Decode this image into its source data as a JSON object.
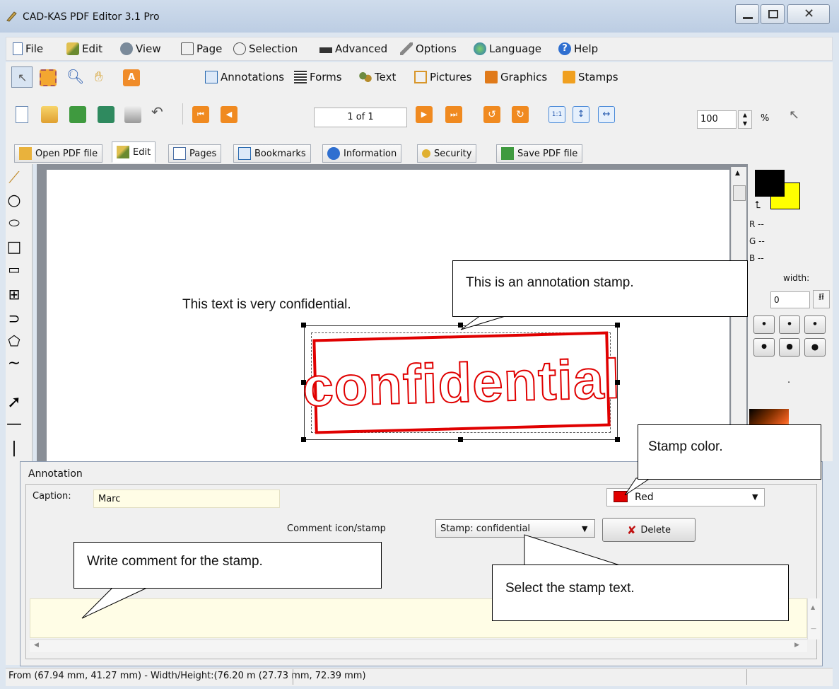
{
  "window": {
    "title": "CAD-KAS PDF Editor 3.1 Pro"
  },
  "menu": [
    {
      "label": "File",
      "icon": "document-icon"
    },
    {
      "label": "Edit",
      "icon": "brush-icon"
    },
    {
      "label": "View",
      "icon": "globe-icon"
    },
    {
      "label": "Page",
      "icon": "book-icon"
    },
    {
      "label": "Selection",
      "icon": "lasso-icon"
    },
    {
      "label": "Advanced",
      "icon": "graduation-cap-icon"
    },
    {
      "label": "Options",
      "icon": "wrench-icon"
    },
    {
      "label": "Language",
      "icon": "globe-icon"
    },
    {
      "label": "Help",
      "icon": "help-icon"
    }
  ],
  "toolbar_modes": [
    {
      "label": "Annotations"
    },
    {
      "label": "Forms"
    },
    {
      "label": "Text"
    },
    {
      "label": "Pictures"
    },
    {
      "label": "Graphics"
    },
    {
      "label": "Stamps"
    }
  ],
  "navigation": {
    "page_indicator": "1 of 1",
    "zoom_value": "100",
    "zoom_unit": "%",
    "actual_size": "1:1"
  },
  "tabs": [
    {
      "label": "Open PDF file"
    },
    {
      "label": "Edit"
    },
    {
      "label": "Pages"
    },
    {
      "label": "Bookmarks"
    },
    {
      "label": "Information"
    },
    {
      "label": "Security"
    },
    {
      "label": "Save PDF file"
    }
  ],
  "document": {
    "body_text": "This text is very confidential.",
    "stamp_text": "confidential"
  },
  "color_panel": {
    "r": "R --",
    "g": "G --",
    "b": "B --",
    "line_width_label": "width:",
    "line_width_value": "0",
    "dot": ".",
    "primary_color": "#000000",
    "secondary_color": "#ffff00"
  },
  "annotation_dialog": {
    "title": "Annotation",
    "caption_label": "Caption:",
    "caption_value": "Marc",
    "color_value": "Red",
    "color_swatch": "#e00000",
    "comment_label": "Comment icon/stamp",
    "stamp_select": "Stamp: confidential",
    "delete_label": "Delete"
  },
  "callouts": {
    "stamp": "This is an annotation stamp.",
    "color": "Stamp color.",
    "comment": "Write comment for the stamp.",
    "select": "Select the stamp text."
  },
  "status": {
    "text": "From (67.94 mm, 41.27 mm) - Width/Height:(76.20 m (27.73 mm, 72.39 mm)"
  },
  "colors": {
    "stamp_red": "#e00000",
    "comment_bg": "#fffde6"
  }
}
